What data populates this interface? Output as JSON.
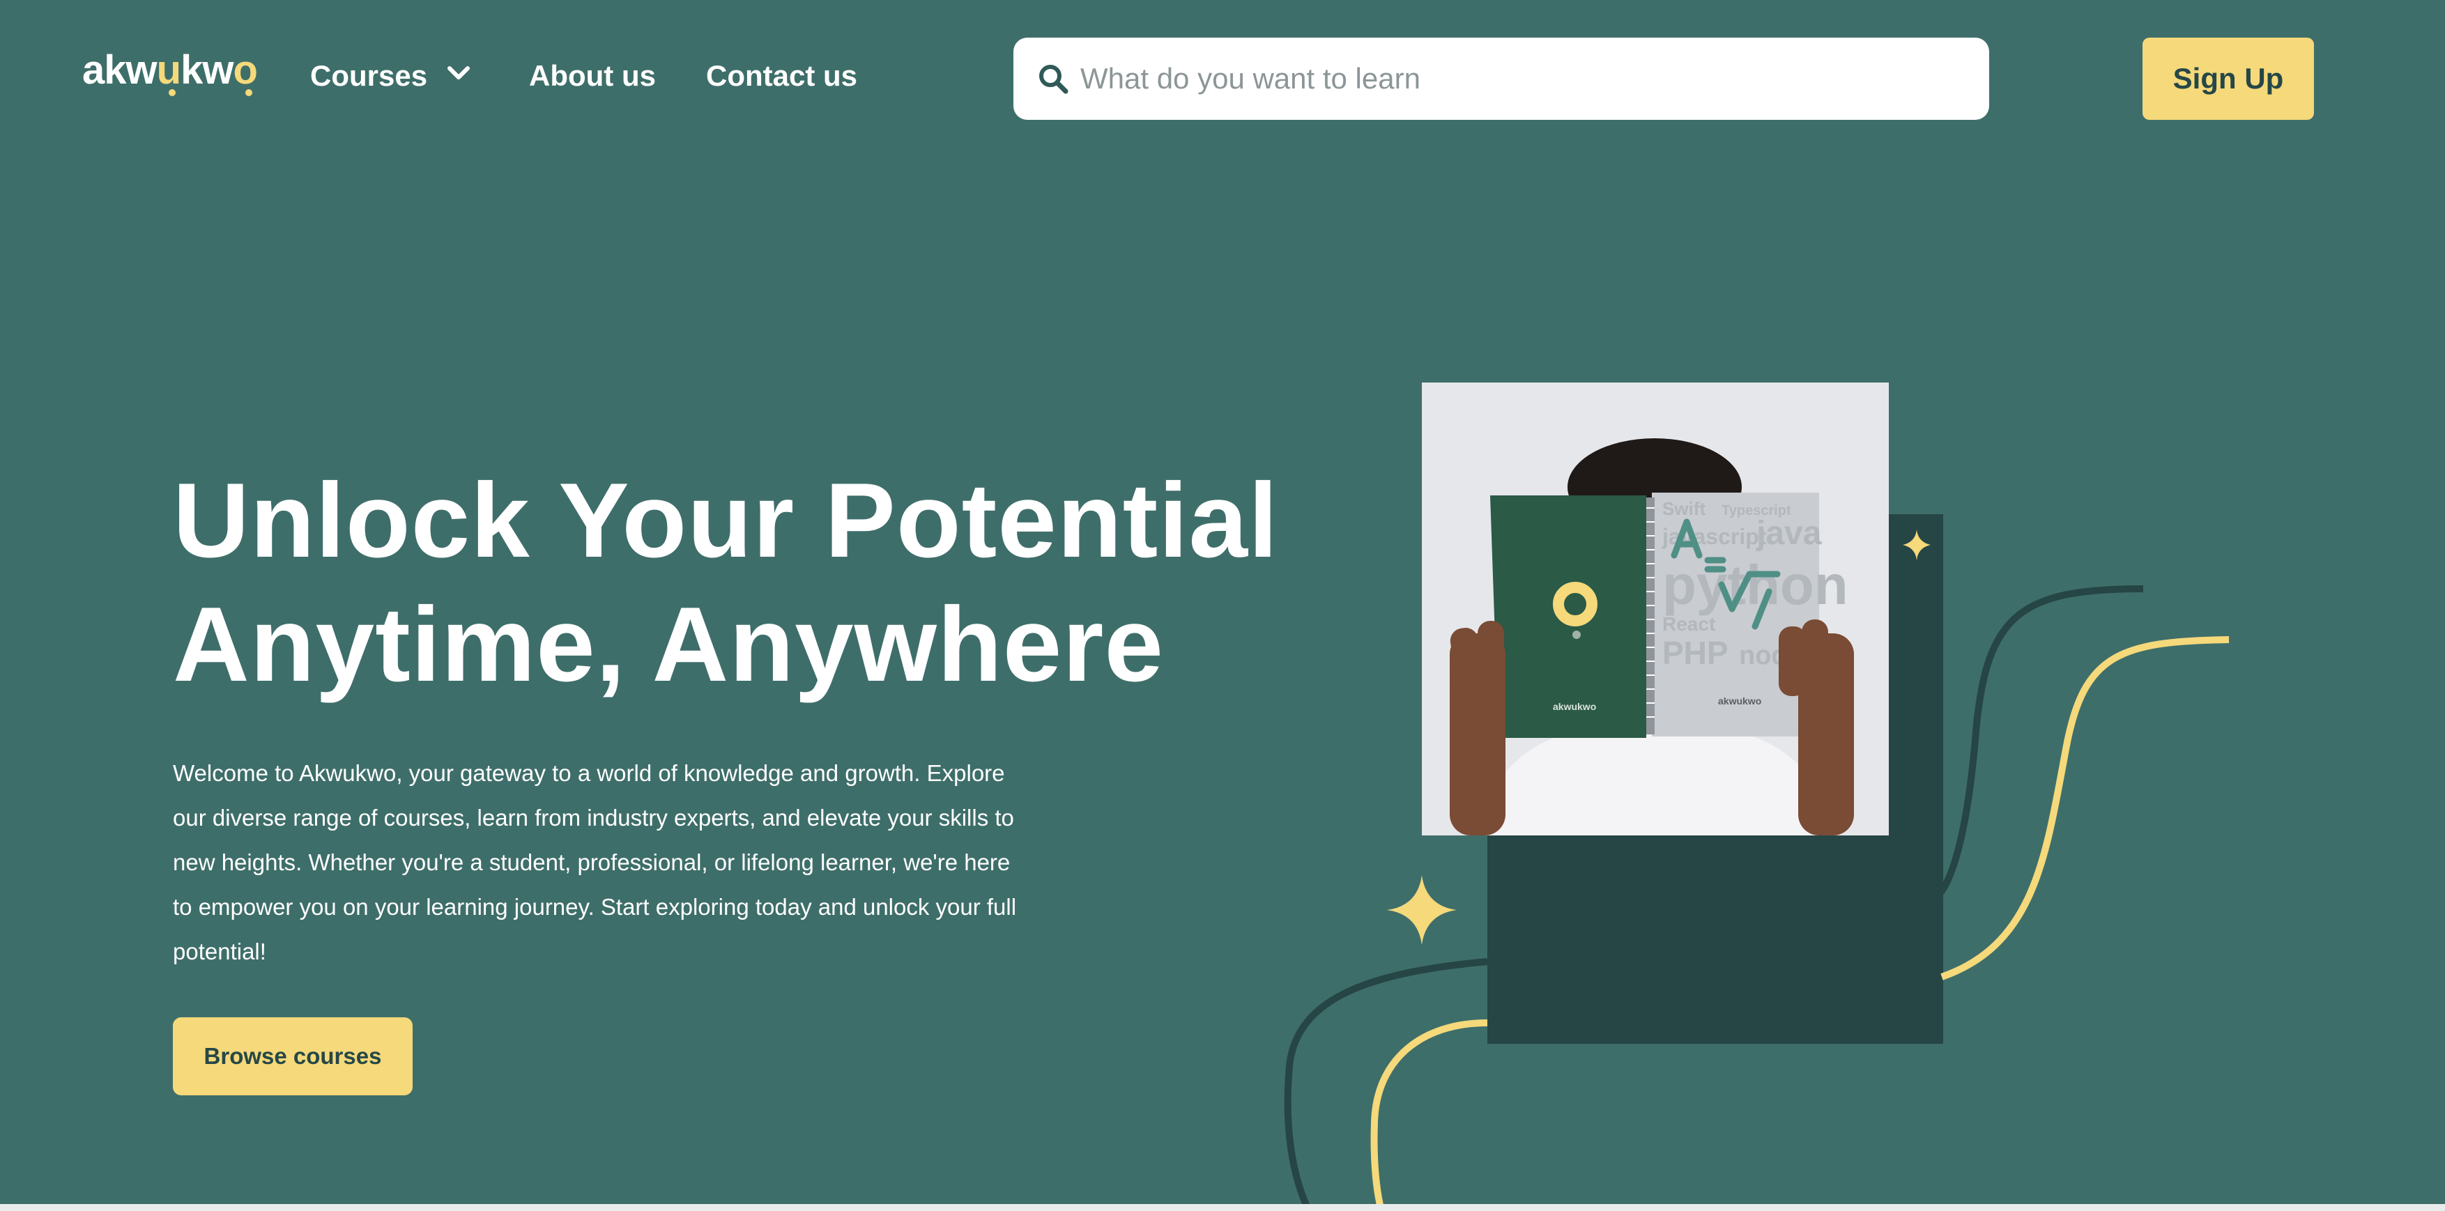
{
  "nav": {
    "logo_parts": [
      "akw",
      "u",
      "kw",
      "o"
    ],
    "links": [
      {
        "label": "Courses"
      },
      {
        "label": "About us"
      },
      {
        "label": "Contact us"
      }
    ],
    "search_placeholder": "What do you want to learn",
    "signup_label": "Sign Up"
  },
  "hero": {
    "title_lines": [
      "Unlock Your Potential",
      "Anytime, Anywhere"
    ],
    "description": "Welcome to Akwukwo, your gateway to a world of knowledge and growth. Explore our diverse range of courses, learn from industry experts, and elevate your skills to new heights. Whether you're a student, professional, or lifelong learner, we're here to empower you on your learning journey. Start exploring today and unlock your full potential!",
    "cta_label": "Browse courses"
  },
  "book": {
    "front_brand": "akwukwo",
    "back_brand": "akwukwo",
    "cover_words": [
      "Swift",
      "Typescript",
      "javascript",
      "java",
      "python",
      "React",
      "PHP",
      "nodejs"
    ]
  },
  "colors": {
    "background": "#3e6e6a",
    "accent_yellow": "#f5d97a",
    "dark_teal": "#264545",
    "text_on_button": "#264747"
  }
}
